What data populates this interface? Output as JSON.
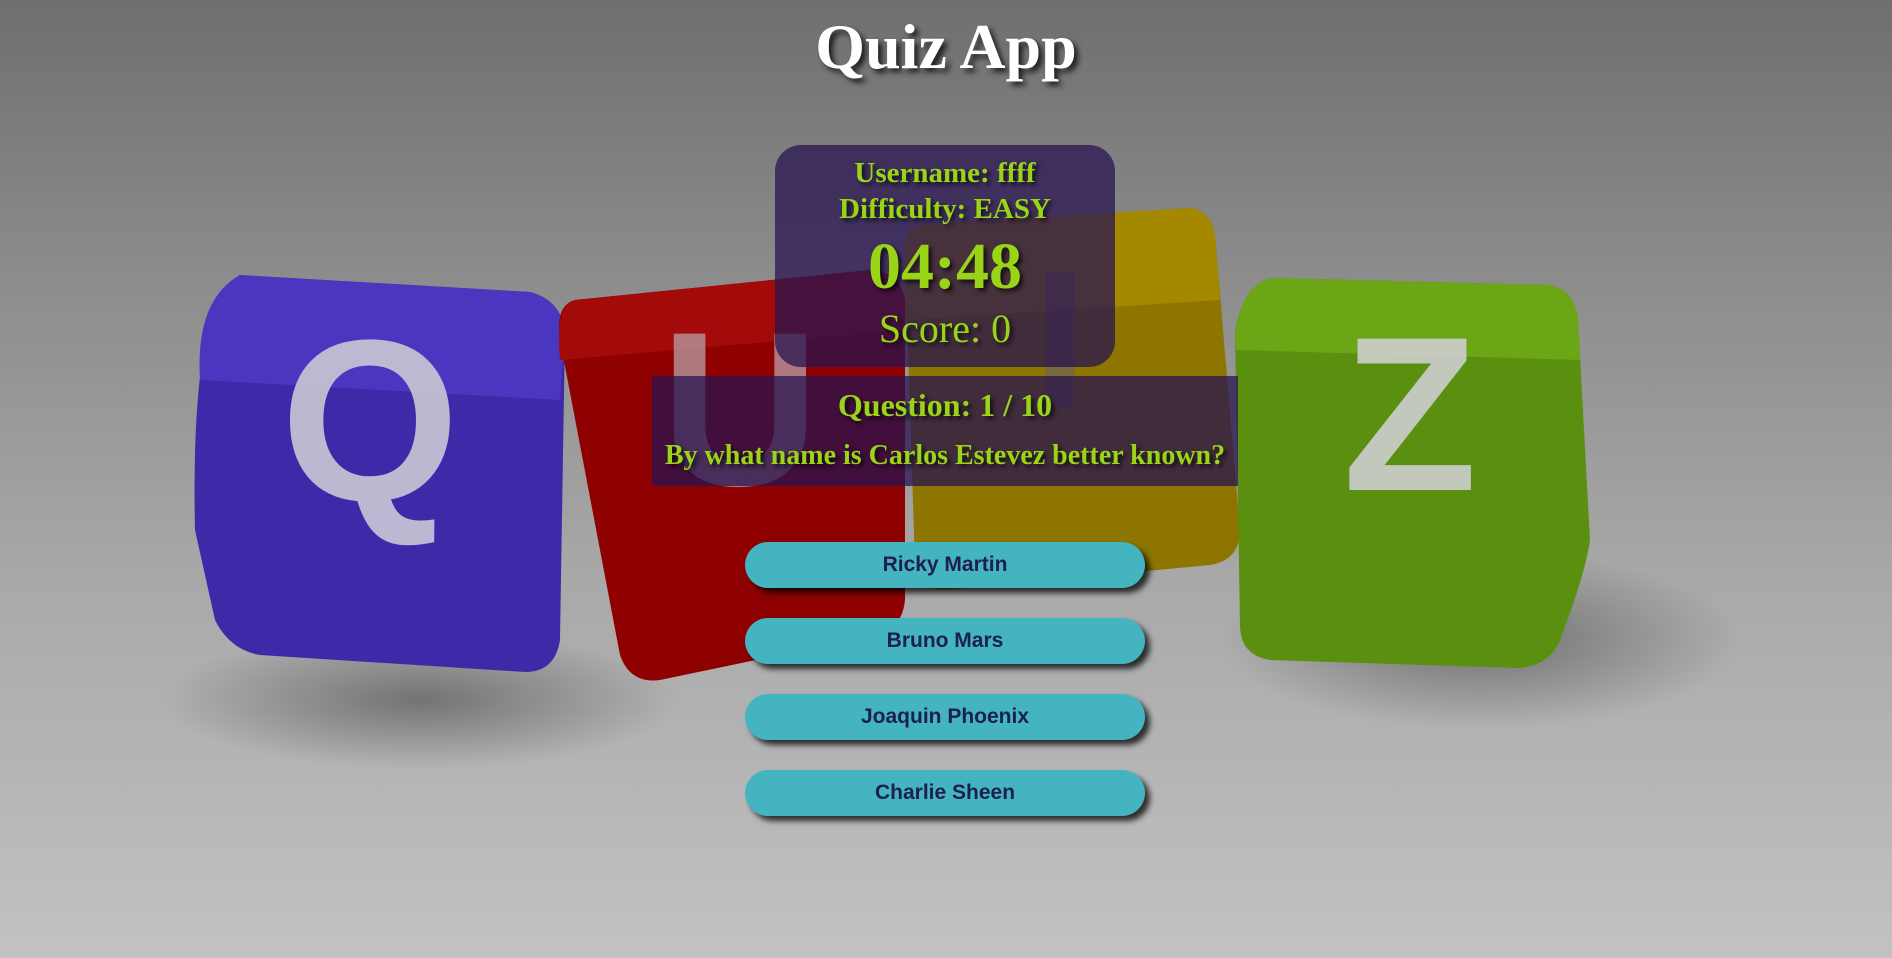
{
  "app": {
    "title": "Quiz App"
  },
  "info": {
    "username_label": "Username: ffff",
    "difficulty_label": "Difficulty: EASY",
    "timer": "04:48",
    "score_label": "Score: 0"
  },
  "question": {
    "counter_label": "Question: 1 / 10",
    "text": "By what name is Carlos Estevez better known?"
  },
  "answers": [
    {
      "label": "Ricky Martin"
    },
    {
      "label": "Bruno Mars"
    },
    {
      "label": "Joaquin Phoenix"
    },
    {
      "label": "Charlie Sheen"
    }
  ],
  "colors": {
    "accent_text": "#9ad417",
    "panel_bg": "#281450",
    "button_bg": "#44b4c1",
    "button_text": "#1d1f4e"
  },
  "background": {
    "letters": [
      "Q",
      "U",
      "I",
      "Z"
    ]
  }
}
